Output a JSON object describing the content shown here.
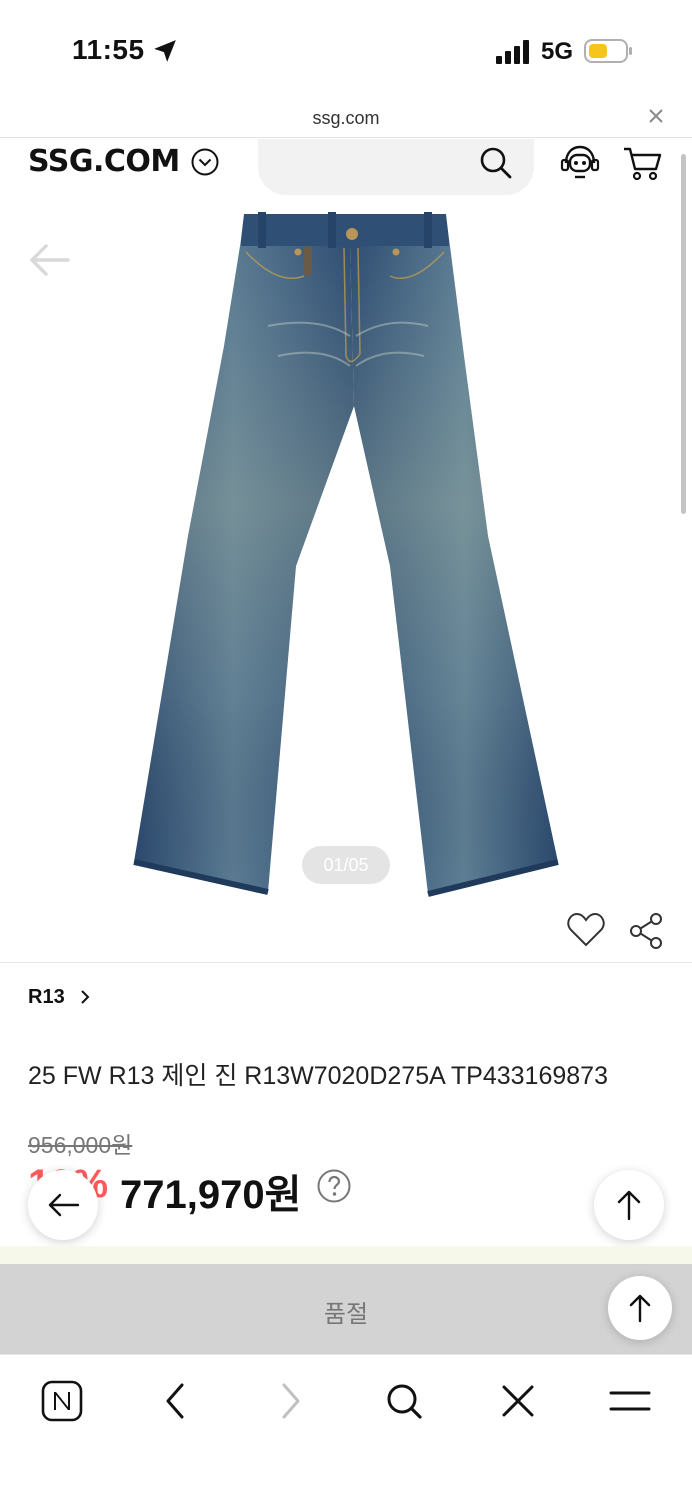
{
  "status_bar": {
    "time": "11:55",
    "network": "5G",
    "battery_color": "#f5c518"
  },
  "browser": {
    "url": "ssg.com"
  },
  "header": {
    "logo": "SSG.COM"
  },
  "gallery": {
    "page_indicator": "01/05",
    "current_page": 1,
    "total_pages": 5
  },
  "product": {
    "brand": "R13",
    "title": "25 FW R13 제인 진 R13W7020D275A TP433169873",
    "original_price": "956,000원",
    "discount": "19%",
    "sale_price": "771,970원"
  },
  "purchase": {
    "status": "품절"
  },
  "colors": {
    "discount_red": "#ff5a5a",
    "soldout_bg": "#d3d3d3"
  },
  "icons": [
    "location-arrow-icon",
    "signal-icon",
    "battery-icon",
    "close-icon",
    "chevron-down-icon",
    "search-icon",
    "customer-service-icon",
    "cart-icon",
    "arrow-left-icon",
    "heart-icon",
    "share-icon",
    "chevron-right-icon",
    "help-icon",
    "arrow-up-icon",
    "naver-icon",
    "back-icon",
    "forward-icon",
    "close-tab-icon",
    "menu-icon"
  ]
}
